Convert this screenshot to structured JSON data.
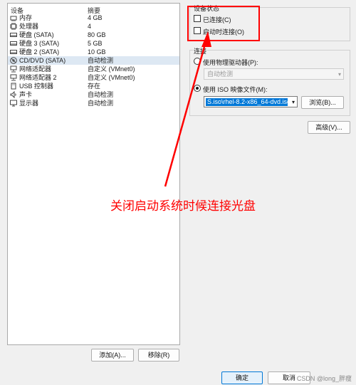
{
  "device_list": {
    "headers": {
      "device": "设备",
      "summary": "摘要"
    },
    "rows": [
      {
        "icon": "memory-icon",
        "name": "内存",
        "summary": "4 GB"
      },
      {
        "icon": "cpu-icon",
        "name": "处理器",
        "summary": "4"
      },
      {
        "icon": "hard-disk-icon",
        "name": "硬盘 (SATA)",
        "summary": "80 GB"
      },
      {
        "icon": "hard-disk-icon",
        "name": "硬盘 3 (SATA)",
        "summary": "5 GB"
      },
      {
        "icon": "hard-disk-icon",
        "name": "硬盘 2 (SATA)",
        "summary": "10 GB"
      },
      {
        "icon": "cd-dvd-icon",
        "name": "CD/DVD (SATA)",
        "summary": "自动检测"
      },
      {
        "icon": "network-adapter-icon",
        "name": "网络适配器",
        "summary": "自定义 (VMnet0)"
      },
      {
        "icon": "network-adapter-icon",
        "name": "网络适配器 2",
        "summary": "自定义 (VMnet0)"
      },
      {
        "icon": "usb-icon",
        "name": "USB 控制器",
        "summary": "存在"
      },
      {
        "icon": "speaker-icon",
        "name": "声卡",
        "summary": "自动检测"
      },
      {
        "icon": "display-icon",
        "name": "显示器",
        "summary": "自动检测"
      }
    ],
    "selected_index": 5,
    "add_button": "添加(A)...",
    "remove_button": "移除(R)"
  },
  "device_status": {
    "title": "设备状态",
    "connected_label": "已连接(C)",
    "connect_at_power_on_label": "启动时连接(O)",
    "connected": false,
    "connect_at_power_on": false
  },
  "connection": {
    "title": "连接",
    "physical_drive_label": "使用物理驱动器(P):",
    "physical_drive_value": "自动检测",
    "iso_label": "使用 ISO 映像文件(M):",
    "iso_value": "S.iso\\rhel-8.2-x86_64-dvd.iso",
    "browse_button": "浏览(B)...",
    "selected_option": "iso"
  },
  "advanced_button": "高级(V)...",
  "footer": {
    "ok_button": "确定",
    "cancel_button": "取消"
  },
  "annotation": {
    "text": "关闭启动系统时候连接光盘",
    "color": "#ff0000"
  },
  "watermark": "CSDN @long_胖瘦"
}
